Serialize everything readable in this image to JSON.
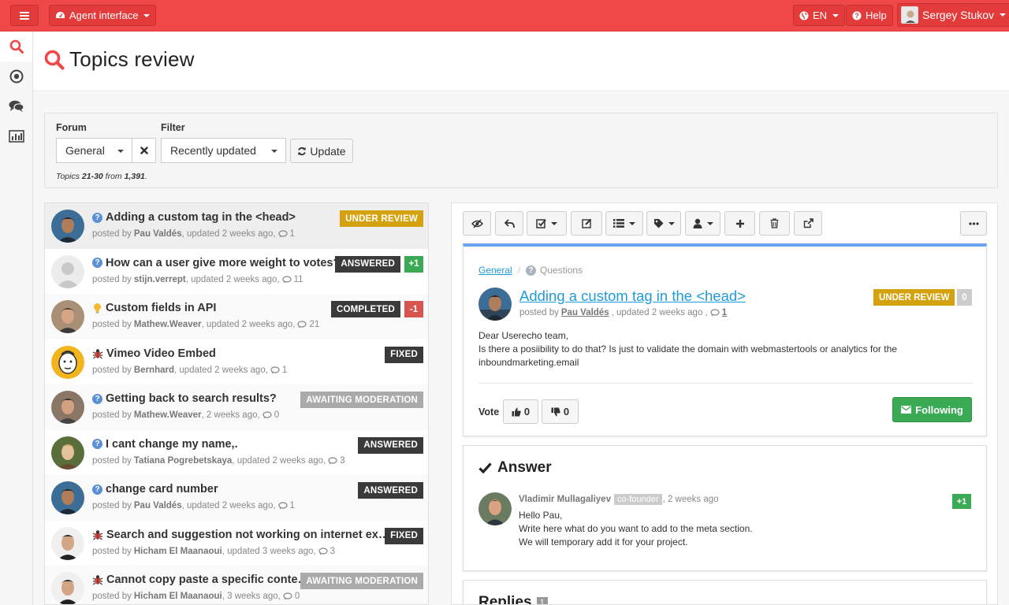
{
  "topbar": {
    "menu_icon": "hamburger-icon",
    "app_switch_label": "Agent interface",
    "language_label": "EN",
    "help_label": "Help",
    "user_name": "Sergey Stukov",
    "accent_color": "#f04848"
  },
  "sidenav": {
    "items": [
      {
        "icon": "search-icon",
        "active": true
      },
      {
        "icon": "target-icon",
        "active": false
      },
      {
        "icon": "comments-icon",
        "active": false
      },
      {
        "icon": "bar-chart-icon",
        "active": false
      }
    ]
  },
  "page": {
    "title": "Topics review"
  },
  "filters": {
    "forum_label": "Forum",
    "forum_value": "General",
    "filter_label": "Filter",
    "filter_value": "Recently updated",
    "update_label": "Update",
    "summary_prefix": "Topics",
    "summary_range": "21-30",
    "summary_from": "from",
    "summary_total": "1,391",
    "summary_end": "."
  },
  "topics": [
    {
      "title": "Adding a custom tag in the <head>",
      "type": "question",
      "author": "Pau Valdés",
      "time": ", updated 2 weeks ago,",
      "comments": "1",
      "status": "UNDER REVIEW",
      "status_color": "#d4a20f",
      "vote": "",
      "selected": true
    },
    {
      "title": "How can a user give more weight to votes?",
      "type": "question",
      "author": "stijn.verrept",
      "time": ", updated 2 weeks ago,",
      "comments": "11",
      "status": "ANSWERED",
      "status_color": "#3a3a3a",
      "vote": "+1",
      "vote_color": "#3aaa55"
    },
    {
      "title": "Custom fields in API",
      "type": "idea",
      "author": "Mathew.Weaver",
      "time": ", updated 2 weeks ago,",
      "comments": "21",
      "status": "COMPLETED",
      "status_color": "#3a3a3a",
      "vote": "-1",
      "vote_color": "#d9534f"
    },
    {
      "title": "Vimeo Video Embed",
      "type": "bug",
      "author": "Bernhard",
      "time": ", updated 2 weeks ago,",
      "comments": "1",
      "status": "FIXED",
      "status_color": "#3a3a3a",
      "vote": ""
    },
    {
      "title": "Getting back to search results?",
      "type": "question",
      "author": "Mathew.Weaver",
      "time": ", 2 weeks ago,",
      "comments": "0",
      "status": "AWAITING MODERATION",
      "status_color": "#aaaaaa",
      "vote": ""
    },
    {
      "title": "I cant change my name,.",
      "type": "question",
      "author": "Tatiana Pogrebetskaya",
      "time": ", updated 2 weeks ago,",
      "comments": "3",
      "status": "ANSWERED",
      "status_color": "#3a3a3a",
      "vote": ""
    },
    {
      "title": "change card number",
      "type": "question",
      "author": "Pau Valdés",
      "time": ", updated 2 weeks ago,",
      "comments": "1",
      "status": "ANSWERED",
      "status_color": "#3a3a3a",
      "vote": ""
    },
    {
      "title": "Search and suggestion not working on internet ex…",
      "type": "bug",
      "author": "Hicham El Maanaoui",
      "time": ", updated 3 weeks ago,",
      "comments": "3",
      "status": "FIXED",
      "status_color": "#3a3a3a",
      "vote": ""
    },
    {
      "title": "Cannot copy paste a specific conte…",
      "type": "bug",
      "author": "Hicham El Maanaoui",
      "time": ", 3 weeks ago,",
      "comments": "0",
      "status": "AWAITING MODERATION",
      "status_color": "#aaaaaa",
      "vote": ""
    }
  ],
  "topic_meta": {
    "posted_by": "posted by"
  },
  "detail": {
    "toolbar": [
      "eye-slash-icon",
      "reply-icon",
      "check-square-icon",
      "edit-icon",
      "list-icon",
      "tag-icon",
      "user-icon",
      "plus-icon",
      "trash-icon",
      "external-link-icon",
      "more-icon"
    ],
    "breadcrumb_forum": "General",
    "breadcrumb_sep": "/",
    "breadcrumb_category": "Questions",
    "title": "Adding a custom tag in the <head>",
    "status": "UNDER REVIEW",
    "score": "0",
    "posted_by": "posted by",
    "author": "Pau Valdés",
    "time": ", updated 2 weeks ago ,",
    "comments": "1",
    "body": [
      "Dear Userecho team,",
      "Is there a posiibility to do that? Is just to validate the domain with webmastertools or analytics for the",
      "inboundmarketing.email"
    ],
    "vote_label": "Vote",
    "upvotes": "0",
    "downvotes": "0",
    "following_label": "Following",
    "following_color": "#3aaa55"
  },
  "answer": {
    "heading": "Answer",
    "author": "Vladimir Mullagaliyev",
    "role": "co-founder",
    "time": ", 2 weeks ago",
    "vote": "+1",
    "lines": [
      "Hello Pau,",
      "Write here what do you want to add to the meta section.",
      "We will temporary add it for your project."
    ]
  },
  "replies": {
    "heading": "Replies",
    "count": "1"
  }
}
